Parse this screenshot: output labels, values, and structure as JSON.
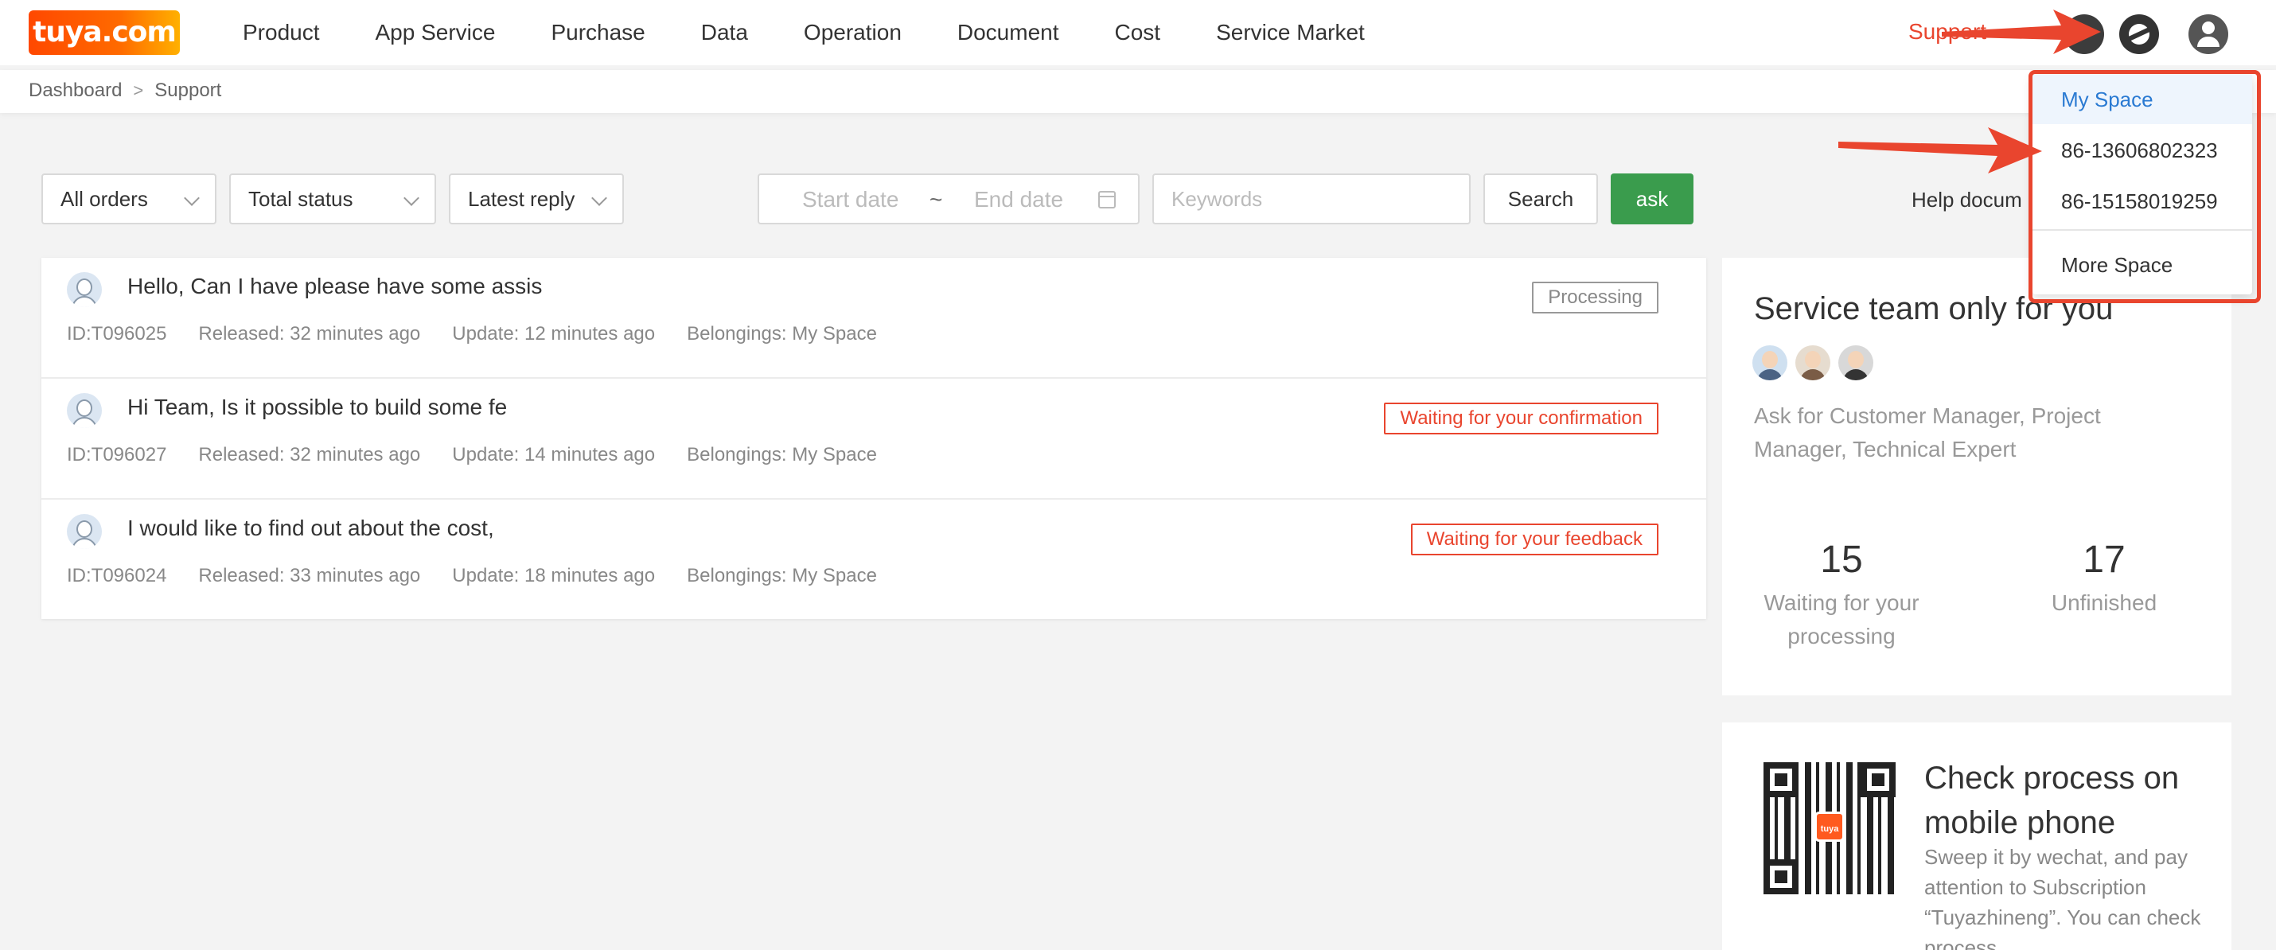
{
  "header": {
    "logo_text": "tuya.com",
    "nav": [
      "Product",
      "App Service",
      "Purchase",
      "Data",
      "Operation",
      "Document",
      "Cost",
      "Service Market"
    ],
    "support_label": "Support"
  },
  "breadcrumb": {
    "items": [
      "Dashboard",
      "Support"
    ],
    "separator": ">"
  },
  "filters": {
    "orders": "All orders",
    "status": "Total status",
    "sort": "Latest reply",
    "start_date_placeholder": "Start date",
    "date_separator": "~",
    "end_date_placeholder": "End date",
    "keywords_placeholder": "Keywords",
    "search_label": "Search",
    "ask_label": "ask",
    "help_label": "Help docum"
  },
  "tickets": [
    {
      "title": "Hello, Can I have please have some assis",
      "id": "ID:T096025",
      "released": "Released: 32 minutes ago",
      "update": "Update: 12 minutes ago",
      "belongings": "Belongings: My Space",
      "status": "Processing",
      "status_color": "#999999"
    },
    {
      "title": "Hi Team, Is it possible to build some fe",
      "id": "ID:T096027",
      "released": "Released: 32 minutes ago",
      "update": "Update: 14 minutes ago",
      "belongings": "Belongings: My Space",
      "status": "Waiting for your confirmation",
      "status_color": "#e9452e"
    },
    {
      "title": "I would like to find out about the cost,",
      "id": "ID:T096024",
      "released": "Released: 33 minutes ago",
      "update": "Update: 18 minutes ago",
      "belongings": "Belongings: My Space",
      "status": "Waiting for your feedback",
      "status_color": "#e9452e"
    }
  ],
  "service_team": {
    "title": "Service team only for you",
    "description": "Ask for Customer Manager, Project Manager, Technical Expert",
    "stats": [
      {
        "value": "15",
        "label_line1": "Waiting for your",
        "label_line2": "processing"
      },
      {
        "value": "17",
        "label_line1": "Unfinished",
        "label_line2": ""
      }
    ]
  },
  "mobile": {
    "title": "Check process on mobile phone",
    "description": "Sweep it by wechat, and pay attention to Subscription “Tuyazhineng”. You can check process",
    "qr_logo_text": "tuya"
  },
  "space_menu": {
    "items": [
      "My Space",
      "86-13606802323",
      "86-15158019259"
    ],
    "more": "More Space"
  },
  "colors": {
    "accent_red": "#e9452e",
    "ask_green": "#3a9c4d",
    "link_blue": "#2a7ad2"
  }
}
